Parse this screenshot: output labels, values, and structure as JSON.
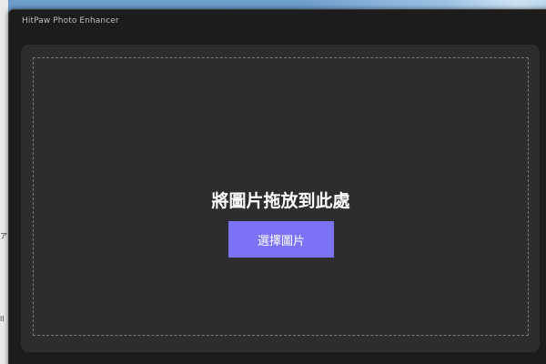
{
  "window": {
    "title": "HitPaw Photo Enhancer"
  },
  "dropzone": {
    "title": "將圖片拖放到此處",
    "select_button_label": "選擇圖片"
  },
  "desktop": {
    "left_edge_chars": [
      "ア",
      "ll"
    ]
  },
  "colors": {
    "accent": "#7b73f5",
    "panel": "#2d2d2d",
    "window": "#1c1c1c"
  }
}
